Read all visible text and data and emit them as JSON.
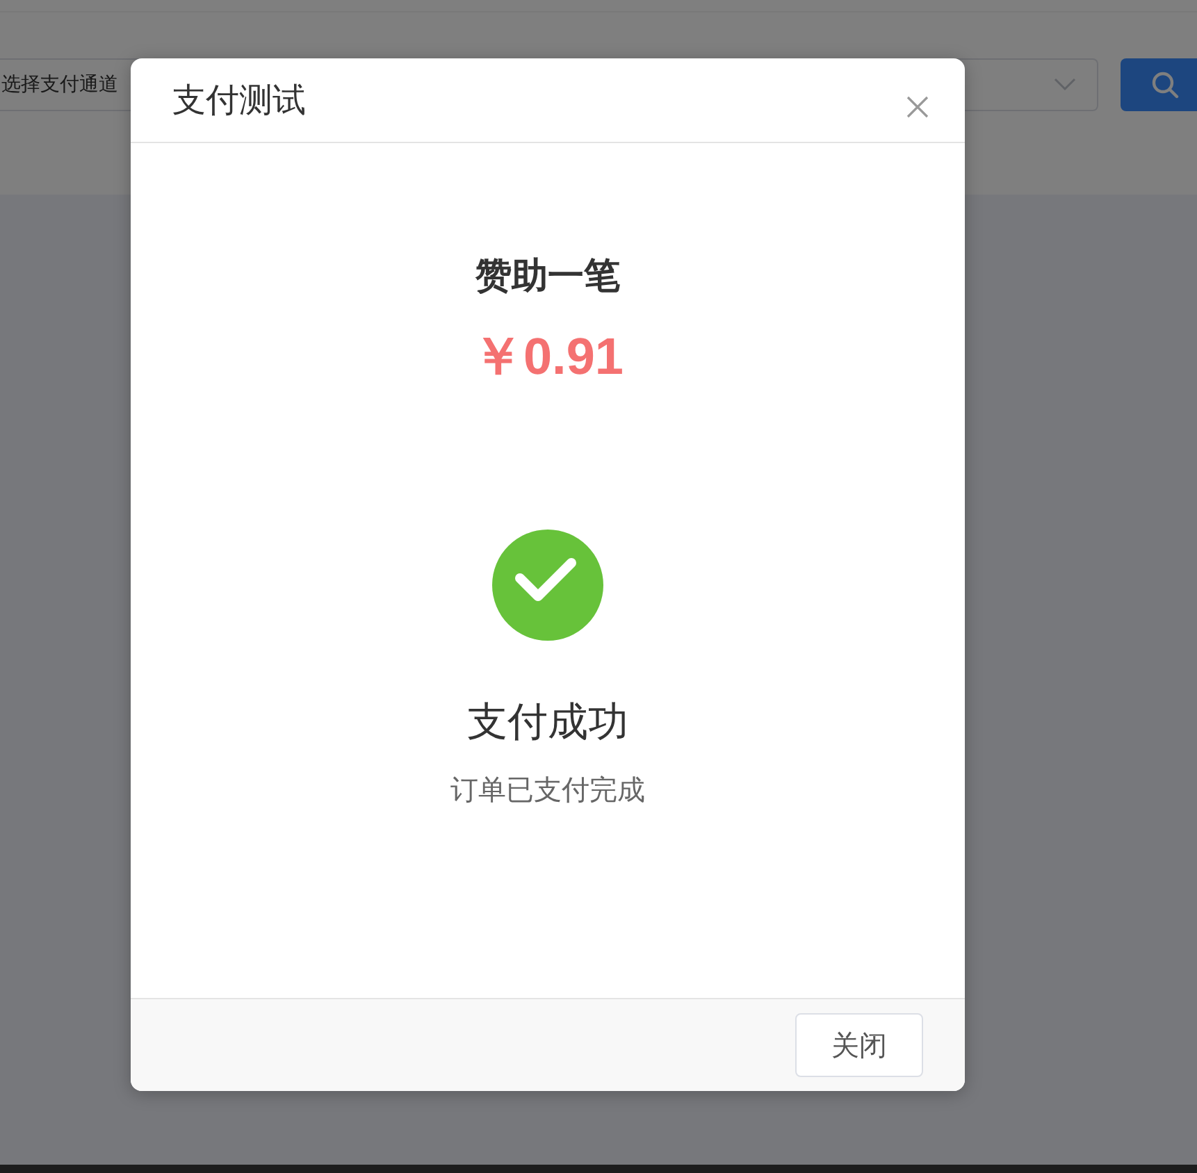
{
  "page": {
    "channel_select": {
      "placeholder": "选择支付通道"
    }
  },
  "dialog": {
    "title": "支付测试",
    "item_name": "赞助一笔",
    "amount": "￥0.91",
    "result": {
      "title": "支付成功",
      "message": "订单已支付完成"
    },
    "buttons": [
      {
        "label": "关闭"
      }
    ]
  }
}
